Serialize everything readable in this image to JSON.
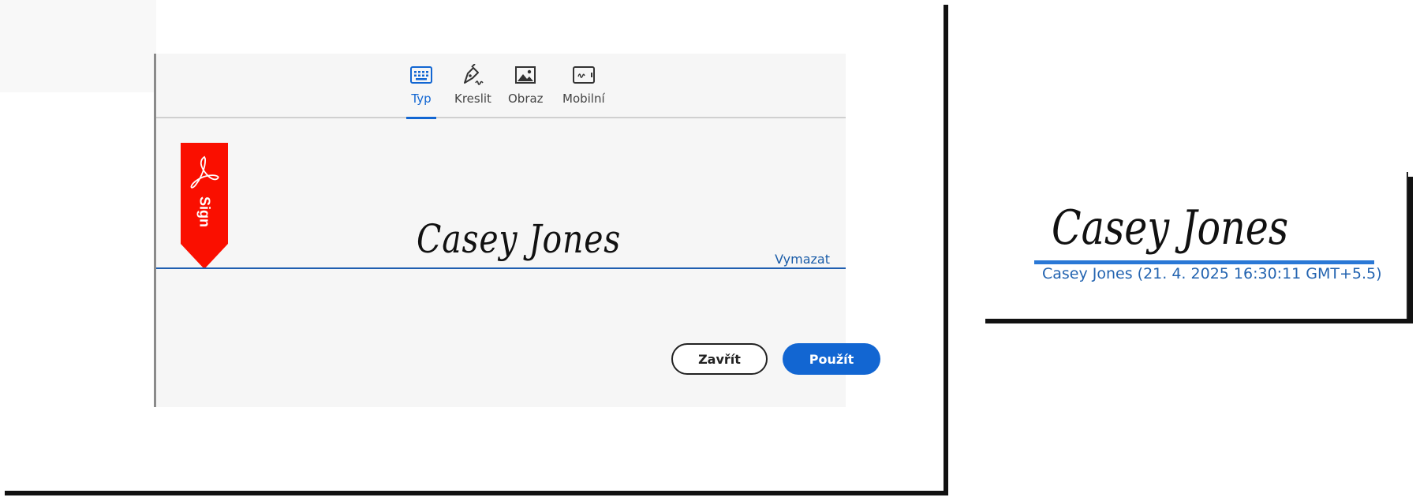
{
  "tabs": [
    {
      "label": "Typ",
      "icon": "keyboard-icon",
      "active": true
    },
    {
      "label": "Kreslit",
      "icon": "pen-icon",
      "active": false
    },
    {
      "label": "Obraz",
      "icon": "image-icon",
      "active": false
    },
    {
      "label": "Mobilní",
      "icon": "mobile-signature-icon",
      "active": false
    }
  ],
  "sign_badge": {
    "label": "Sign",
    "color": "#fa0f00"
  },
  "signature": {
    "text": "Casey Jones"
  },
  "clear_label": "Vymazat",
  "buttons": {
    "close": "Zavřít",
    "apply": "Použít"
  },
  "preview": {
    "signature": "Casey Jones",
    "caption": "Casey Jones (21. 4. 2025 16:30:11 GMT+5.5)"
  },
  "colors": {
    "accent": "#1266d2",
    "adobe_red": "#fa0f00"
  }
}
